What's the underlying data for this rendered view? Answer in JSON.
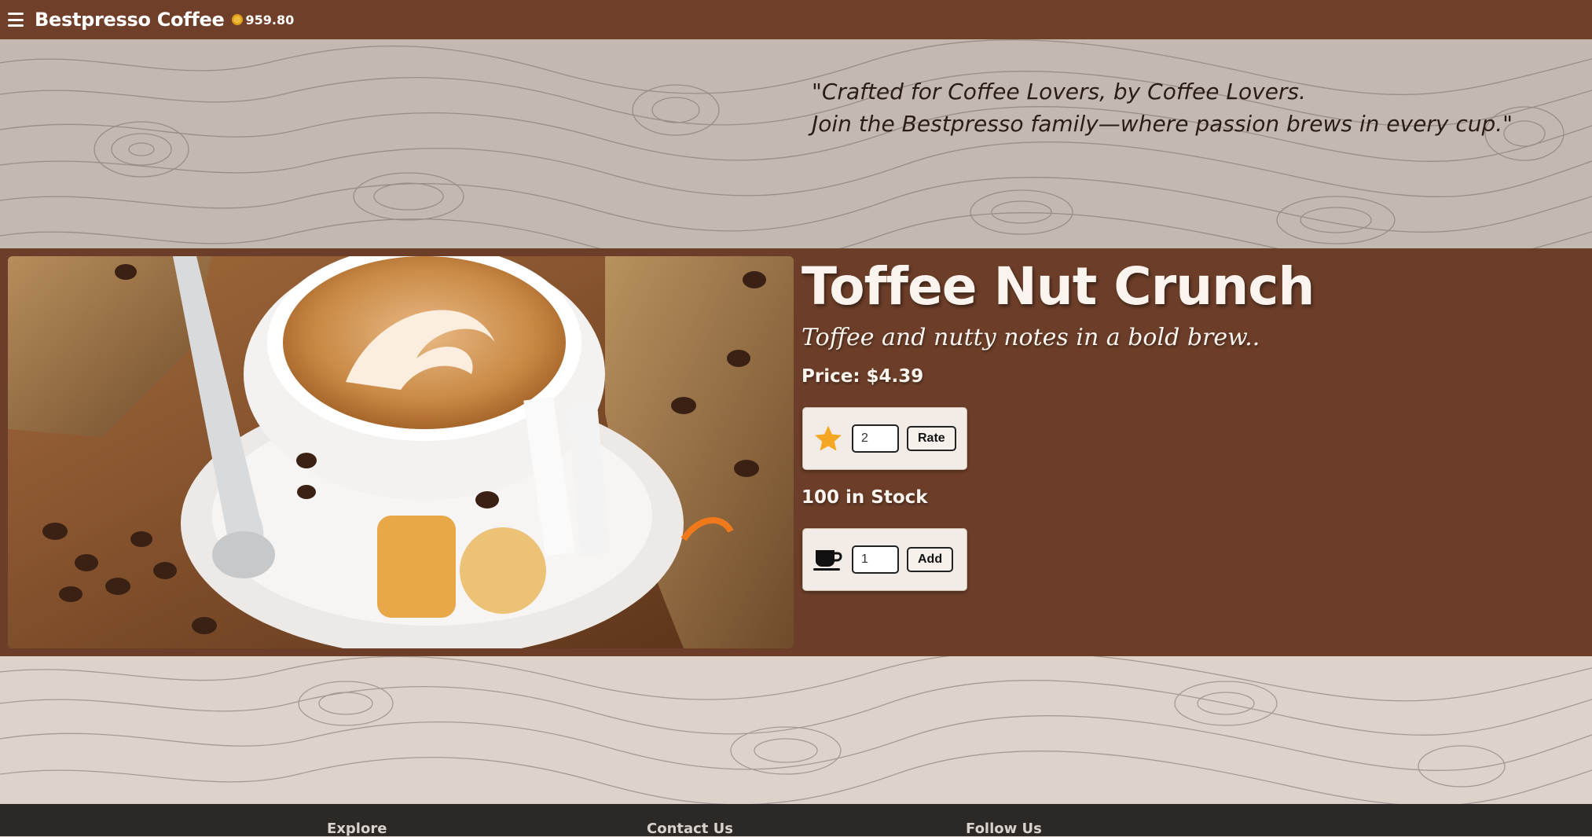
{
  "nav": {
    "brand": "Bestpresso Coffee",
    "balance": "959.80"
  },
  "banner": {
    "quote_line1": "\"Crafted for Coffee Lovers, by Coffee Lovers.",
    "quote_line2": "Join the Bestpresso family—where passion brews in every cup.\""
  },
  "product": {
    "name": "Toffee Nut Crunch",
    "tagline": "Toffee and nutty notes in a bold brew..",
    "price": "Price: $4.39",
    "stock": "100 in Stock",
    "rating_value": "2",
    "rate_label": "Rate",
    "quantity_value": "1",
    "add_label": "Add"
  },
  "footer": {
    "explore": "Explore",
    "contact": "Contact Us",
    "follow": "Follow Us"
  },
  "colors": {
    "nav_bg": "#6f3f2a",
    "product_bg": "#6c3e29",
    "footer_bg": "#2b2826",
    "star": "#f5a623"
  },
  "icons": [
    "menu-icon",
    "coin-icon",
    "star-icon",
    "coffee-cup-icon"
  ]
}
